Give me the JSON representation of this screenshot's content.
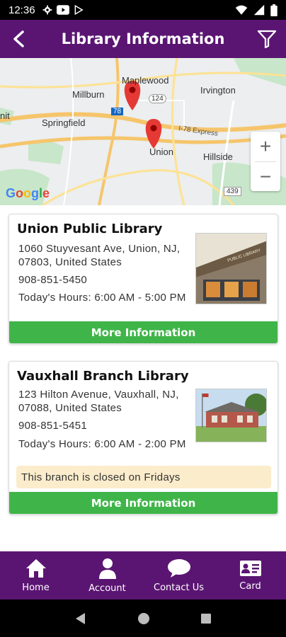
{
  "status_bar": {
    "time": "12:36"
  },
  "header": {
    "title": "Library Information"
  },
  "map": {
    "places": [
      "Maplewood",
      "Millburn",
      "Irvington",
      "Springfield",
      "Union",
      "Hillside",
      "nit"
    ],
    "roads": [
      "124",
      "78",
      "439",
      "I-78 Express"
    ],
    "google_label": "Google"
  },
  "libraries": [
    {
      "name": "Union Public Library",
      "address": "1060 Stuyvesant Ave, Union, NJ, 07803, United States",
      "phone": "908-851-5450",
      "hours": "Today's Hours: 6:00 AM - 5:00 PM",
      "button": "More Information"
    },
    {
      "name": "Vauxhall Branch Library",
      "address": "123 Hilton Avenue, Vauxhall, NJ, 07088, United States",
      "phone": "908-851-5451",
      "hours": "Today's Hours: 6:00 AM - 2:00 PM",
      "notice": "This branch is closed on Fridays",
      "button": "More Information"
    }
  ],
  "bottom_nav": {
    "items": [
      {
        "label": "Home",
        "icon": "home-icon"
      },
      {
        "label": "Account",
        "icon": "person-icon"
      },
      {
        "label": "Contact Us",
        "icon": "chat-bubble-icon"
      },
      {
        "label": "Card",
        "icon": "id-card-icon"
      }
    ]
  },
  "colors": {
    "primary": "#5a1572",
    "button": "#3fb549",
    "notice": "#fbeccb"
  }
}
